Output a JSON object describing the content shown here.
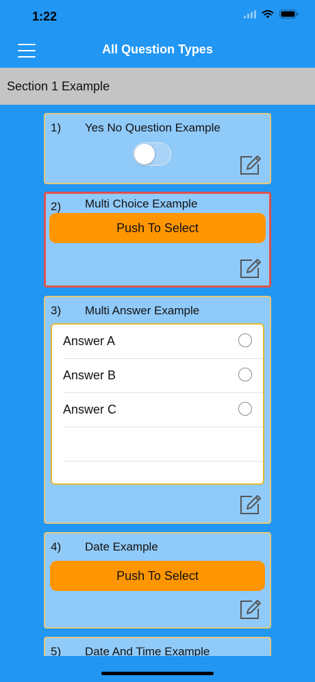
{
  "status": {
    "time": "1:22",
    "icons": [
      "wifi-icon",
      "battery-icon"
    ]
  },
  "header": {
    "title": "All Question Types",
    "menu_icon": "hamburger-menu-icon"
  },
  "section": {
    "title": "Section 1 Example"
  },
  "questions": [
    {
      "num": "1)",
      "text": "Yes No Question Example",
      "type": "yes-no",
      "toggle_on": false
    },
    {
      "num": "2)",
      "text": "Multi Choice Example",
      "type": "multi-choice",
      "button": "Push To Select",
      "selected": true
    },
    {
      "num": "3)",
      "text": "Multi Answer Example",
      "type": "multi-answer",
      "answers": [
        "Answer A",
        "Answer B",
        "Answer C"
      ]
    },
    {
      "num": "4)",
      "text": "Date Example",
      "type": "date",
      "button": "Push To Select"
    },
    {
      "num": "5)",
      "text": "Date And Time Example",
      "type": "datetime"
    }
  ],
  "colors": {
    "background": "#2196F3",
    "card": "#90CAF9",
    "button": "#FF9500",
    "selected_border": "#E0524A",
    "section_bar": "#C4C4C4"
  }
}
